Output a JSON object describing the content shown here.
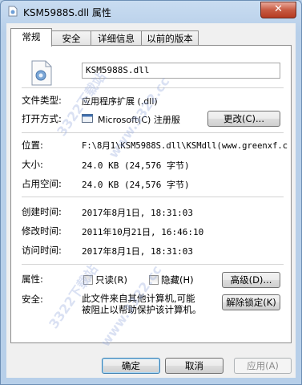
{
  "window": {
    "title": "KSM5988S.dll 属性",
    "close_glyph": "✕"
  },
  "tabs": [
    {
      "label": "常规"
    },
    {
      "label": "安全"
    },
    {
      "label": "详细信息"
    },
    {
      "label": "以前的版本"
    }
  ],
  "general": {
    "filename": "KSM5988S.dll",
    "type_label": "文件类型:",
    "type_value": "应用程序扩展 (.dll)",
    "open_label": "打开方式:",
    "open_value": "Microsoft(C) 注册服",
    "change_button": "更改(C)...",
    "location_label": "位置:",
    "location_value": "F:\\8月1\\KSM5988S.dll\\KSMdll(www.greenxf.c",
    "size_label": "大小:",
    "size_value": "24.0 KB (24,576 字节)",
    "disk_label": "占用空间:",
    "disk_value": "24.0 KB (24,576 字节)",
    "created_label": "创建时间:",
    "created_value": "2017年8月1日, 18:31:03",
    "modified_label": "修改时间:",
    "modified_value": "2011年10月21日, 16:46:10",
    "accessed_label": "访问时间:",
    "accessed_value": "2017年8月1日, 18:31:03",
    "attr_label": "属性:",
    "readonly_label": "只读(R)",
    "hidden_label": "隐藏(H)",
    "advanced_button": "高级(D)...",
    "security_label": "安全:",
    "security_text_1": "此文件来自其他计算机,可能",
    "security_text_2": "被阻止以帮助保护该计算机。",
    "unblock_button": "解除锁定(K)"
  },
  "footer": {
    "ok_button": "确定",
    "cancel_button": "取消",
    "apply_button": "应用(A)"
  },
  "watermark": {
    "text_1": "3322下载站",
    "text_2": "www.3322.cc"
  }
}
